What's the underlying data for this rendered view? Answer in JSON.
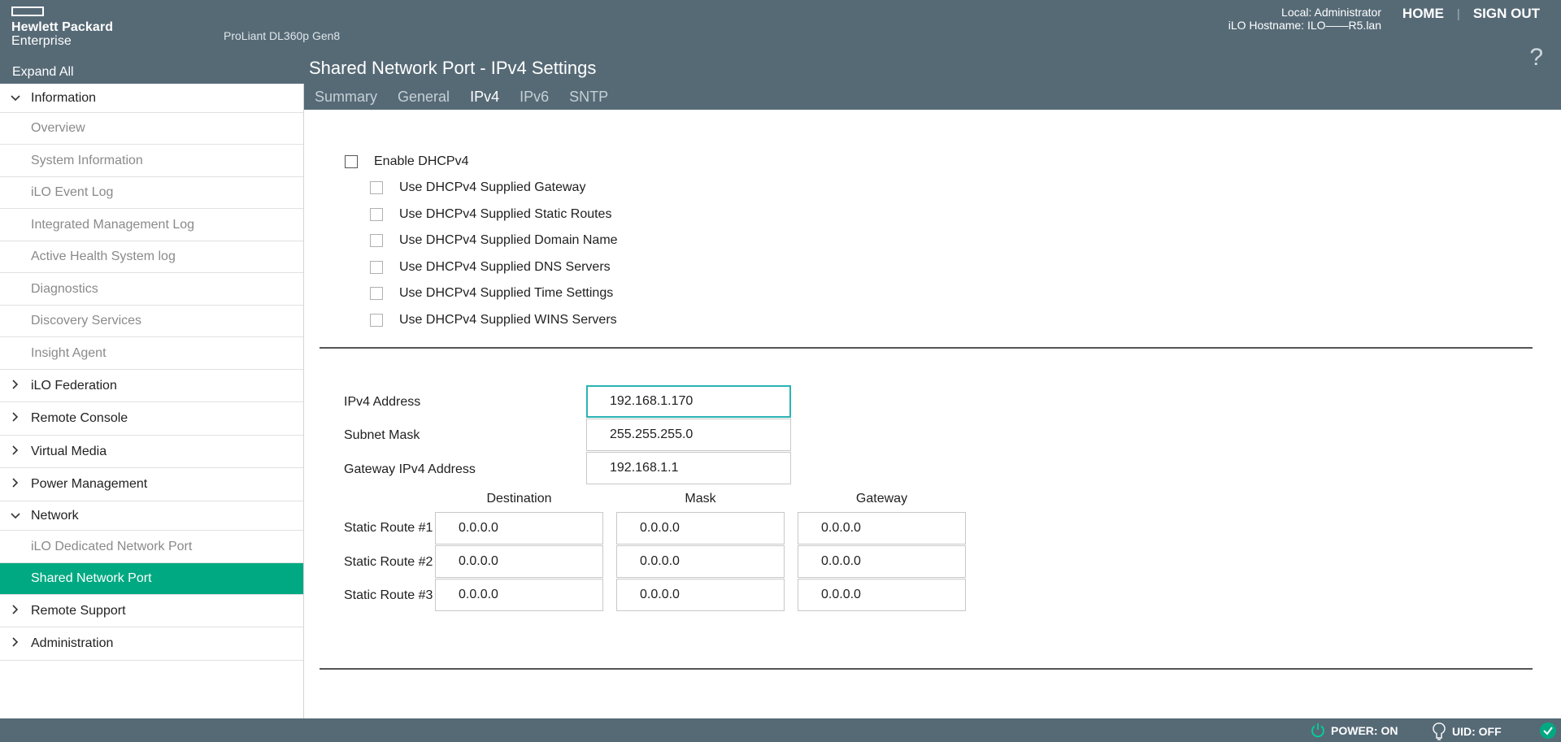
{
  "header": {
    "logo_line1": "Hewlett Packard",
    "logo_line2": "Enterprise",
    "product": "ProLiant DL360p Gen8",
    "user": "Local: Administrator",
    "hostname": "iLO Hostname: ILO——R5.lan",
    "home": "HOME",
    "separator": "|",
    "signout": "SIGN OUT",
    "help": "?"
  },
  "sidebar": {
    "expand_all": "Expand All",
    "items": [
      {
        "label": "Information",
        "type": "section",
        "expanded": true,
        "icon": "chevron-down-icon"
      },
      {
        "label": "Overview",
        "type": "sub"
      },
      {
        "label": "System Information",
        "type": "sub"
      },
      {
        "label": "iLO Event Log",
        "type": "sub"
      },
      {
        "label": "Integrated Management Log",
        "type": "sub"
      },
      {
        "label": "Active Health System log",
        "type": "sub"
      },
      {
        "label": "Diagnostics",
        "type": "sub"
      },
      {
        "label": "Discovery Services",
        "type": "sub"
      },
      {
        "label": "Insight Agent",
        "type": "sub"
      },
      {
        "label": "iLO Federation",
        "type": "section",
        "expanded": false,
        "icon": "chevron-right-icon"
      },
      {
        "label": "Remote Console",
        "type": "section",
        "expanded": false,
        "icon": "chevron-right-icon"
      },
      {
        "label": "Virtual Media",
        "type": "section",
        "expanded": false,
        "icon": "chevron-right-icon"
      },
      {
        "label": "Power Management",
        "type": "section",
        "expanded": false,
        "icon": "chevron-right-icon"
      },
      {
        "label": "Network",
        "type": "section",
        "expanded": true,
        "icon": "chevron-down-icon"
      },
      {
        "label": "iLO Dedicated Network Port",
        "type": "sub"
      },
      {
        "label": "Shared Network Port",
        "type": "sub",
        "active": true
      },
      {
        "label": "Remote Support",
        "type": "section",
        "expanded": false,
        "icon": "chevron-right-icon"
      },
      {
        "label": "Administration",
        "type": "section",
        "expanded": false,
        "icon": "chevron-right-icon"
      }
    ]
  },
  "page": {
    "title": "Shared Network Port - IPv4 Settings",
    "tabs": [
      "Summary",
      "General",
      "IPv4",
      "IPv6",
      "SNTP"
    ],
    "active_tab": "IPv4"
  },
  "dhcp": {
    "enable_label": "Enable DHCPv4",
    "enable_checked": false,
    "options": [
      "Use DHCPv4 Supplied Gateway",
      "Use DHCPv4 Supplied Static Routes",
      "Use DHCPv4 Supplied Domain Name",
      "Use DHCPv4 Supplied DNS Servers",
      "Use DHCPv4 Supplied Time Settings",
      "Use DHCPv4 Supplied WINS Servers"
    ]
  },
  "ipv4": {
    "address_label": "IPv4 Address",
    "address_value": "192.168.1.170",
    "subnet_label": "Subnet Mask",
    "subnet_value": "255.255.255.0",
    "gateway_label": "Gateway IPv4 Address",
    "gateway_value": "192.168.1.1"
  },
  "static_routes": {
    "columns": [
      "Destination",
      "Mask",
      "Gateway"
    ],
    "rows": [
      {
        "label": "Static Route #1",
        "destination": "0.0.0.0",
        "mask": "0.0.0.0",
        "gateway": "0.0.0.0"
      },
      {
        "label": "Static Route #2",
        "destination": "0.0.0.0",
        "mask": "0.0.0.0",
        "gateway": "0.0.0.0"
      },
      {
        "label": "Static Route #3",
        "destination": "0.0.0.0",
        "mask": "0.0.0.0",
        "gateway": "0.0.0.0"
      }
    ]
  },
  "footer": {
    "power": "POWER: ON",
    "uid": "UID: OFF"
  },
  "colors": {
    "header_bg": "#566a76",
    "accent": "#01a982",
    "focus": "#2ab3b3"
  }
}
